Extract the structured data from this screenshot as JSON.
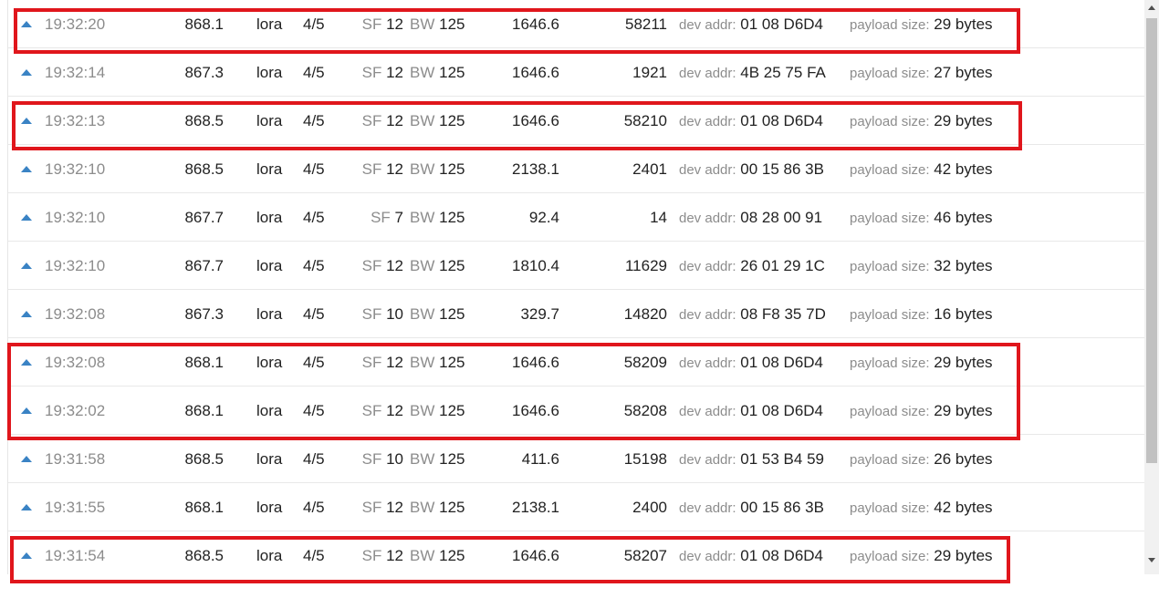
{
  "labels": {
    "sf": "SF",
    "bw": "BW",
    "dev_addr": "dev addr:",
    "payload_size": "payload size:"
  },
  "colors": {
    "highlight": "#e0161c",
    "uplink_icon": "#3a83c4"
  },
  "icons": {
    "uplink": "triangle-up",
    "scroll_up": "triangle-up",
    "scroll_down": "triangle-down"
  },
  "packets": [
    {
      "time": "19:32:20",
      "freq": "868.1",
      "mod": "lora",
      "cr": "4/5",
      "sf": "12",
      "bw": "125",
      "airtime": "1646.6",
      "counter": "58211",
      "dev_addr": "01 08 D6D4",
      "payload": "29 bytes"
    },
    {
      "time": "19:32:14",
      "freq": "867.3",
      "mod": "lora",
      "cr": "4/5",
      "sf": "12",
      "bw": "125",
      "airtime": "1646.6",
      "counter": "1921",
      "dev_addr": "4B 25 75 FA",
      "payload": "27 bytes"
    },
    {
      "time": "19:32:13",
      "freq": "868.5",
      "mod": "lora",
      "cr": "4/5",
      "sf": "12",
      "bw": "125",
      "airtime": "1646.6",
      "counter": "58210",
      "dev_addr": "01 08 D6D4",
      "payload": "29 bytes"
    },
    {
      "time": "19:32:10",
      "freq": "868.5",
      "mod": "lora",
      "cr": "4/5",
      "sf": "12",
      "bw": "125",
      "airtime": "2138.1",
      "counter": "2401",
      "dev_addr": "00 15 86 3B",
      "payload": "42 bytes"
    },
    {
      "time": "19:32:10",
      "freq": "867.7",
      "mod": "lora",
      "cr": "4/5",
      "sf": "7",
      "bw": "125",
      "airtime": "92.4",
      "counter": "14",
      "dev_addr": "08 28 00 91",
      "payload": "46 bytes"
    },
    {
      "time": "19:32:10",
      "freq": "867.7",
      "mod": "lora",
      "cr": "4/5",
      "sf": "12",
      "bw": "125",
      "airtime": "1810.4",
      "counter": "11629",
      "dev_addr": "26 01 29 1C",
      "payload": "32 bytes"
    },
    {
      "time": "19:32:08",
      "freq": "867.3",
      "mod": "lora",
      "cr": "4/5",
      "sf": "10",
      "bw": "125",
      "airtime": "329.7",
      "counter": "14820",
      "dev_addr": "08 F8 35 7D",
      "payload": "16 bytes"
    },
    {
      "time": "19:32:08",
      "freq": "868.1",
      "mod": "lora",
      "cr": "4/5",
      "sf": "12",
      "bw": "125",
      "airtime": "1646.6",
      "counter": "58209",
      "dev_addr": "01 08 D6D4",
      "payload": "29 bytes"
    },
    {
      "time": "19:32:02",
      "freq": "868.1",
      "mod": "lora",
      "cr": "4/5",
      "sf": "12",
      "bw": "125",
      "airtime": "1646.6",
      "counter": "58208",
      "dev_addr": "01 08 D6D4",
      "payload": "29 bytes"
    },
    {
      "time": "19:31:58",
      "freq": "868.5",
      "mod": "lora",
      "cr": "4/5",
      "sf": "10",
      "bw": "125",
      "airtime": "411.6",
      "counter": "15198",
      "dev_addr": "01 53 B4 59",
      "payload": "26 bytes"
    },
    {
      "time": "19:31:55",
      "freq": "868.1",
      "mod": "lora",
      "cr": "4/5",
      "sf": "12",
      "bw": "125",
      "airtime": "2138.1",
      "counter": "2400",
      "dev_addr": "00 15 86 3B",
      "payload": "42 bytes"
    },
    {
      "time": "19:31:54",
      "freq": "868.5",
      "mod": "lora",
      "cr": "4/5",
      "sf": "12",
      "bw": "125",
      "airtime": "1646.6",
      "counter": "58207",
      "dev_addr": "01 08 D6D4",
      "payload": "29 bytes"
    }
  ],
  "highlighted_rows": [
    [
      0,
      0
    ],
    [
      2,
      2
    ],
    [
      7,
      8
    ],
    [
      11,
      11
    ]
  ]
}
